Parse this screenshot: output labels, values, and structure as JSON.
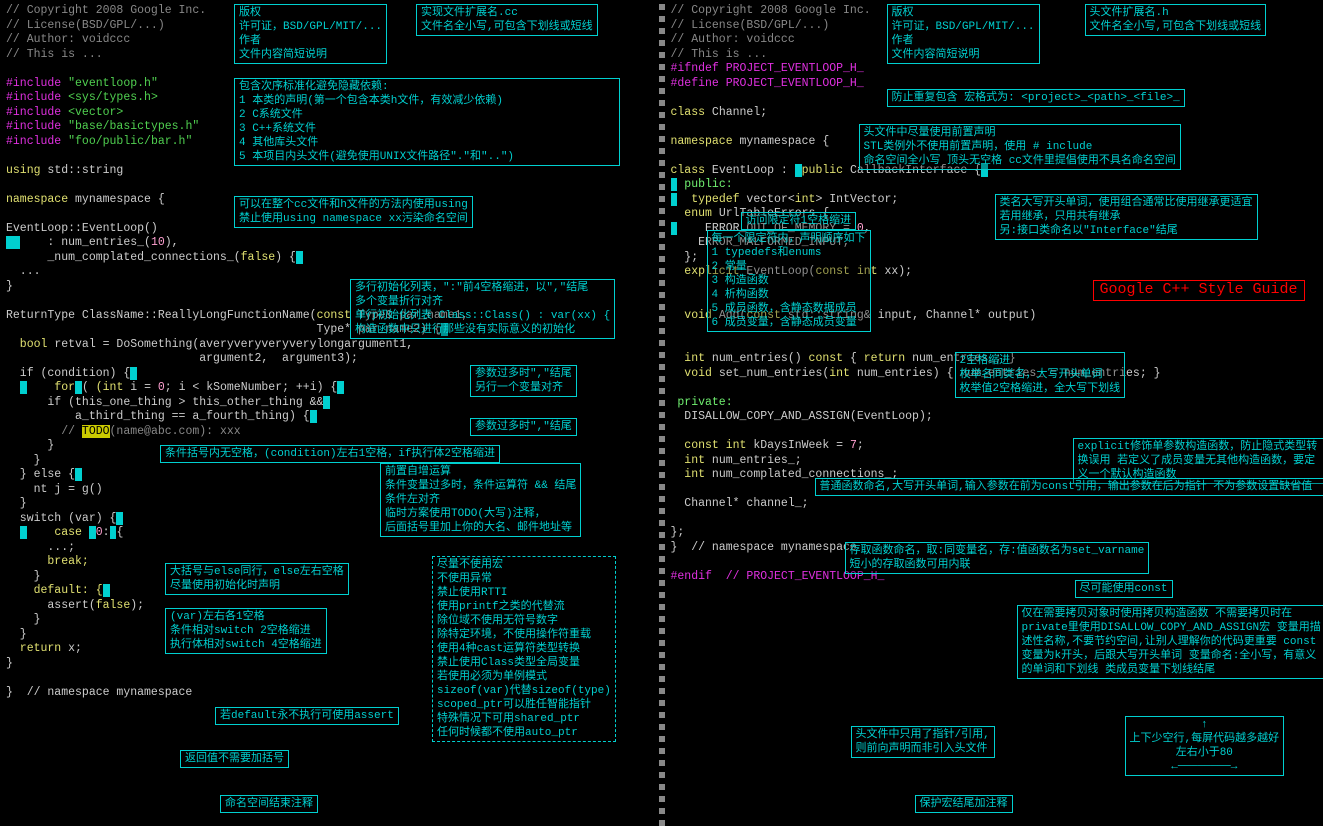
{
  "title_badge": "Google C++ Style Guide",
  "left": {
    "ln1": "// Copyright 2008 Google Inc.",
    "ln2": "// License(BSD/GPL/...)",
    "ln3": "// Author: voidccc",
    "ln4": "// This is ...",
    "inc1": "#include",
    "inc1s": "\"eventloop.h\"",
    "inc2": "#include",
    "inc2s": "<sys/types.h>",
    "inc3": "#include",
    "inc3s": "<vector>",
    "inc4": "#include",
    "inc4s": "\"base/basictypes.h\"",
    "inc5": "#include",
    "inc5s": "\"foo/public/bar.h\"",
    "using": "using",
    "using2": " std::string",
    "ns": "namespace",
    "ns2": " mynamespace {",
    "ctor": "EventLoop::EventLoop()",
    "init1": "    : num_entries_(",
    "init1n": "10",
    "init1e": "),",
    "init2": "      _num_complated_connections_(",
    "init2v": "false",
    "init2e": ") {",
    "init3": "  ...",
    "init4": "}",
    "fn": "ReturnType ClassName::ReallyLongFunctionName(",
    "fnk": "const",
    "fnp": " Type& par_name1,",
    "fn2": "                                             Type* par_name2) {",
    "body1": "  bool",
    "body1b": " retval = DoSomething(averyveryveryverylongargument1,",
    "body2": "                            argument2,  argument3);",
    "if": "  if (condition) {",
    "for": "    for",
    "for2": " (int",
    "for3": " i = ",
    "for3n": "0",
    "for4": "; i < kSomeNumber; ++i) {",
    "ifin": "      if (this_one_thing > this_other_thing &&",
    "ifin2": "          a_third_thing == a_fourth_thing) {",
    "todo": "        // ",
    "todo_lbl": "TODO",
    "todo2": "(name@abc.com): xxx",
    "cb1": "      }",
    "cb2": "    }",
    "else": "  } else {",
    "elsebody": "    nt j = g()",
    "cb3": "  }",
    "sw": "  switch (var) {",
    "case": "    case ",
    "case0": "0",
    ":case_end": ": {",
    "casein": "      ...;",
    "break": "      break;",
    "cb4": "    }",
    "def": "    default: {",
    "assert": "      assert(",
    "assertv": "false",
    "asserte": ");",
    "cb5": "    }",
    "cb6": "  }",
    "ret": "  return x;",
    "cb7": "}",
    "nsend": "}  // namespace mynamespace",
    "box_header": "版权\n许可证，BSD/GPL/MIT/...\n作者\n文件内容简短说明",
    "box_ext": "实现文件扩展名.cc\n文件名全小写,可包含下划线或短线",
    "box_inc": "包含次序标准化避免隐藏依赖:\n1 本类的声明(第一个包含本类h文件，有效减少依赖)\n2 C系统文件\n3 C++系统文件\n4 其他库头文件\n5 本项目内头文件(避免使用UNIX文件路径\".\"和\"..\")",
    "box_using": "可以在整个cc文件和h文件的方法内使用using\n禁止使用using namespace xx污染命名空间",
    "box_ctor": "多行初始化列表，\":\"前4空格缩进，以\",\"结尾\n多个变量折行对齐\n单行初始化列表 Class::Class() : var(xx) {\n构造函数中只进行那些没有实际意义的初始化",
    "box_param": "参数过多时\",\"结尾\n另行一个变量对齐",
    "box_arg": "参数过多时\",\"结尾",
    "box_if": "条件括号内无空格，(condition)左右1空格，if执行体2空格缩进",
    "box_for": "前置自增运算\n条件变量过多时，条件运算符 && 结尾\n条件左对齐\n临时方案使用TODO(大写)注释，\n后面括号里加上你的大名、邮件地址等",
    "box_else": "大括号与else同行，else左右空格\n尽量使用初始化时声明",
    "box_sw": "(var)左右各1空格\n条件相对switch 2空格缩进\n执行体相对switch 4空格缩进",
    "box_assert": "若default永不执行可使用assert",
    "box_ret": "返回值不需要加括号",
    "box_ns": "命名空间结束注释",
    "box_misc": "尽量不使用宏\n不使用异常\n禁止使用RTTI\n使用printf之类的代替流\n除位域不使用无符号数字\n除特定环境，不使用操作符重载\n使用4种cast运算符类型转换\n禁止使用Class类型全局变量\n若使用必须为单例模式\nsizeof(var)代替sizeof(type)\nscoped_ptr可以胜任智能指针\n特殊情况下可用shared_ptr\n任何时候都不使用auto_ptr"
  },
  "right": {
    "ln1": "// Copyright 2008 Google Inc.",
    "ln2": "// License(BSD/GPL/...)",
    "ln3": "// Author: voidccc",
    "ln4": "// This is ...",
    "ifndef": "#ifndef PROJECT_EVENTLOOP_H_",
    "define": "#define PROJECT_EVENTLOOP_H_",
    "fwd": "class",
    "fwd2": " Channel;",
    "ns": "namespace",
    "ns2": " mynamespace {",
    "cls": "class",
    "cls2": " EventLoop : ",
    "cls3": "public",
    "cls4": " CallbackInterface {",
    "pub": " public:",
    "td": "  typedef",
    "td2": " vector<",
    "td3": "int",
    "td4": "> IntVector;",
    "enum": "  enum",
    "enum2": " UrlTableErrors {",
    "en1": "    ERROR_OUT_OF_MEMORY = ",
    "en1n": "0",
    "en1e": ",",
    "en2": "    ERROR_MALFORMED_INPUT,",
    "en3": "  };",
    "exp": "  explicit",
    "exp2": " EventLoop(",
    "exp3": "const int",
    "exp4": " xx);",
    "add": "  void",
    "add2": " Add(",
    "add3": "const",
    "add4": " std::string& input, Channel* output)",
    "get": "  int",
    "get2": " num_entries() ",
    "get3": "const",
    "get4": " { ",
    "get5": "return",
    "get6": " num_entries_; }",
    "set": "  void",
    "set2": " set_num_entries(",
    "set3": "int",
    "set4": " num_entries) { num_entries_ = num_entries; }",
    "priv": " private:",
    "dis": "  DISALLOW_COPY_AND_ASSIGN(EventLoop);",
    "k": "  const int",
    "k2": " kDaysInWeek = ",
    "k3": "7",
    "k4": ";",
    "m1": "  int",
    "m1b": " num_entries_;",
    "m2": "  int",
    "m2b": " num_complated_connections_;",
    "ch": "  Channel* channel_;",
    "cb": "};",
    "nsend": "}  // namespace mynamespace",
    "endif": "#endif  // PROJECT_EVENTLOOP_H_",
    "box_header": "版权\n许可证，BSD/GPL/MIT/...\n作者\n文件内容简短说明",
    "box_ext": "头文件扩展名.h\n文件名全小写,可包含下划线或短线",
    "box_guard": "防止重复包含 宏格式为: <project>_<path>_<file>_",
    "box_fwd": "头文件中尽量使用前置声明\nSTL类例外不使用前置声明，使用 # include\n命名空间全小写 顶头无空格 cc文件里提倡使用不具名命名空间",
    "box_cls": "类名大写开头单词，使用组合通常比使用继承更适宜\n若用继承，只用共有继承\n另:接口类命名以\"Interface\"结尾",
    "box_pub": "访问限定符1空格缩进",
    "box_order": "每一个限定符内，声明顺序如下\n1 typedefs和enums\n2 常量\n3 构造函数\n4 析构函数\n5 成员函数，含静态数据成员\n6 成员变量，含静态成员变量",
    "box_td": "2空格缩进\n枚举名同类名，大写开头单词\n枚举值2空格缩进，全大写下划线",
    "box_exp": "explicit修饰单参数构造函数，防止隐式类型转换误用\n若定义了成员变量无其他构造函数，要定义一个默认构造函数",
    "box_fn": "普通函数命名,大写开头单词,输入参数在前为const引用，输出参数在后为指针\n不为参数设置缺省值",
    "box_acc": "存取函数命名，取:同变量名，存:值函数名为set_varname\n短小的存取函数可用内联",
    "box_const": "尽可能使用const",
    "box_priv": "仅在需要拷贝对象时使用拷贝构造函数\n不需要拷贝时在private里使用DISALLOW_COPY_AND_ASSIGN宏\n变量用描述性名称,不要节约空间,让别人理解你的代码更重要\nconst 变量为k开头，后跟大写开头单词\n变量命名:全小写，有意义的单词和下划线\n类成员变量下划线结尾",
    "box_ptr": "头文件中只用了指针/引用,\n则前向声明而非引入头文件",
    "box_endif": "保护宏结尾加注释",
    "box_len": "上下少空行,每屏代码越多越好\n左右小于80"
  }
}
